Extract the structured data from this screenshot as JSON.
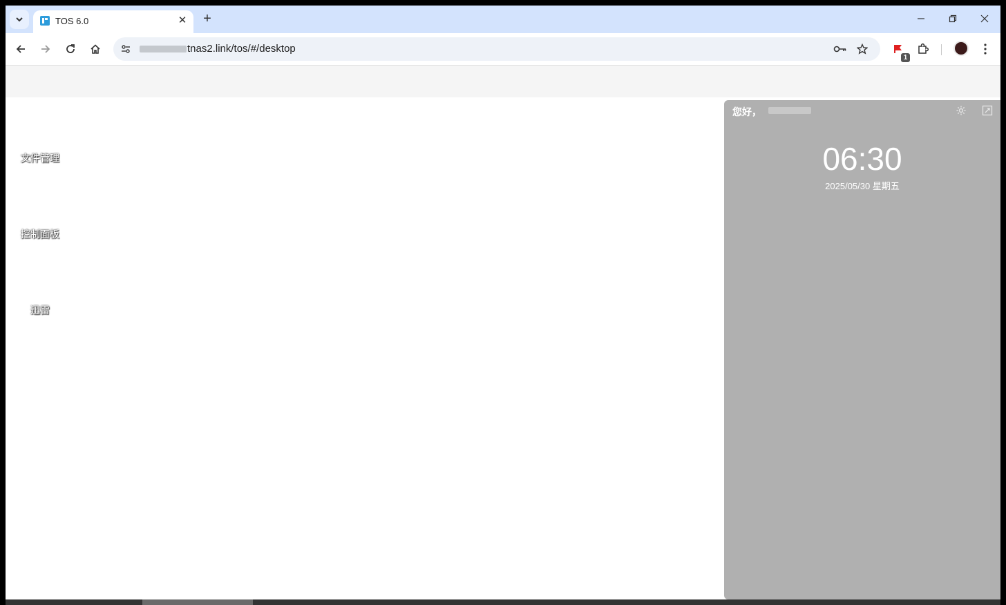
{
  "tab": {
    "title": "TOS 6.0"
  },
  "address_bar": {
    "url": "tnas2.link/tos/#/desktop"
  },
  "extensions": {
    "badge_count": "1"
  },
  "desktop": {
    "icons": [
      {
        "label": "文件管理"
      },
      {
        "label": "控制面板"
      },
      {
        "label": "迅雷"
      }
    ]
  },
  "widget": {
    "greeting": "您好，",
    "time": "06:30",
    "date": "2025/05/30 星期五"
  },
  "icons": {
    "tab_search": "chevron-down-icon",
    "back": "arrow-left-icon",
    "forward": "arrow-right-icon",
    "reload": "reload-icon",
    "home": "home-icon",
    "site_info": "tune-icon",
    "password": "key-icon",
    "bookmark": "star-icon",
    "extension": "puzzle-icon",
    "menu": "kebab-icon",
    "settings": "gear-icon",
    "fullscreen": "expand-icon"
  }
}
